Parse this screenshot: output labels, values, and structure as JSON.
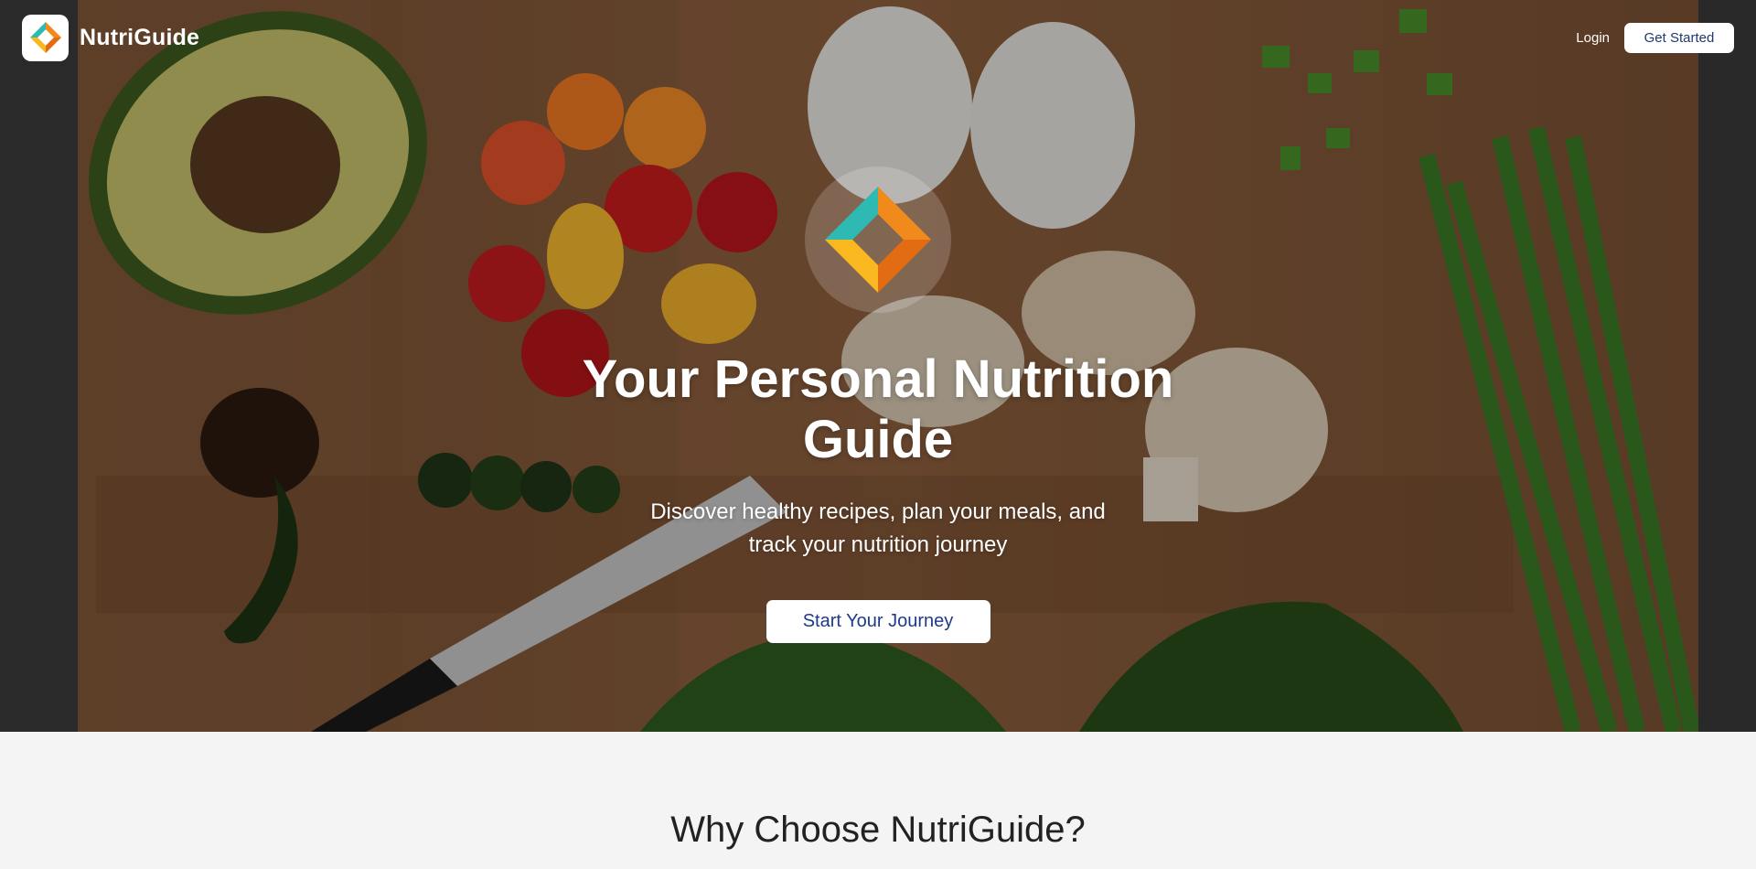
{
  "nav": {
    "brand_name": "NutriGuide",
    "login_label": "Login",
    "cta_label": "Get Started"
  },
  "hero": {
    "title": "Your Personal Nutrition Guide",
    "subtitle": "Discover healthy recipes, plan your meals, and track your nutrition journey",
    "cta_label": "Start Your Journey",
    "background_image": "food-cutting-board-photo"
  },
  "why": {
    "title": "Why Choose NutriGuide?"
  },
  "icons": {
    "brand_logo": "diamond-logo-icon",
    "hero_emblem": "diamond-logo-icon"
  },
  "colors": {
    "teal": "#2fb9b3",
    "orange": "#f08a1c",
    "yellow": "#f9b820",
    "cta_text": "#1e3a8a",
    "section_bg": "#f4f4f4"
  }
}
